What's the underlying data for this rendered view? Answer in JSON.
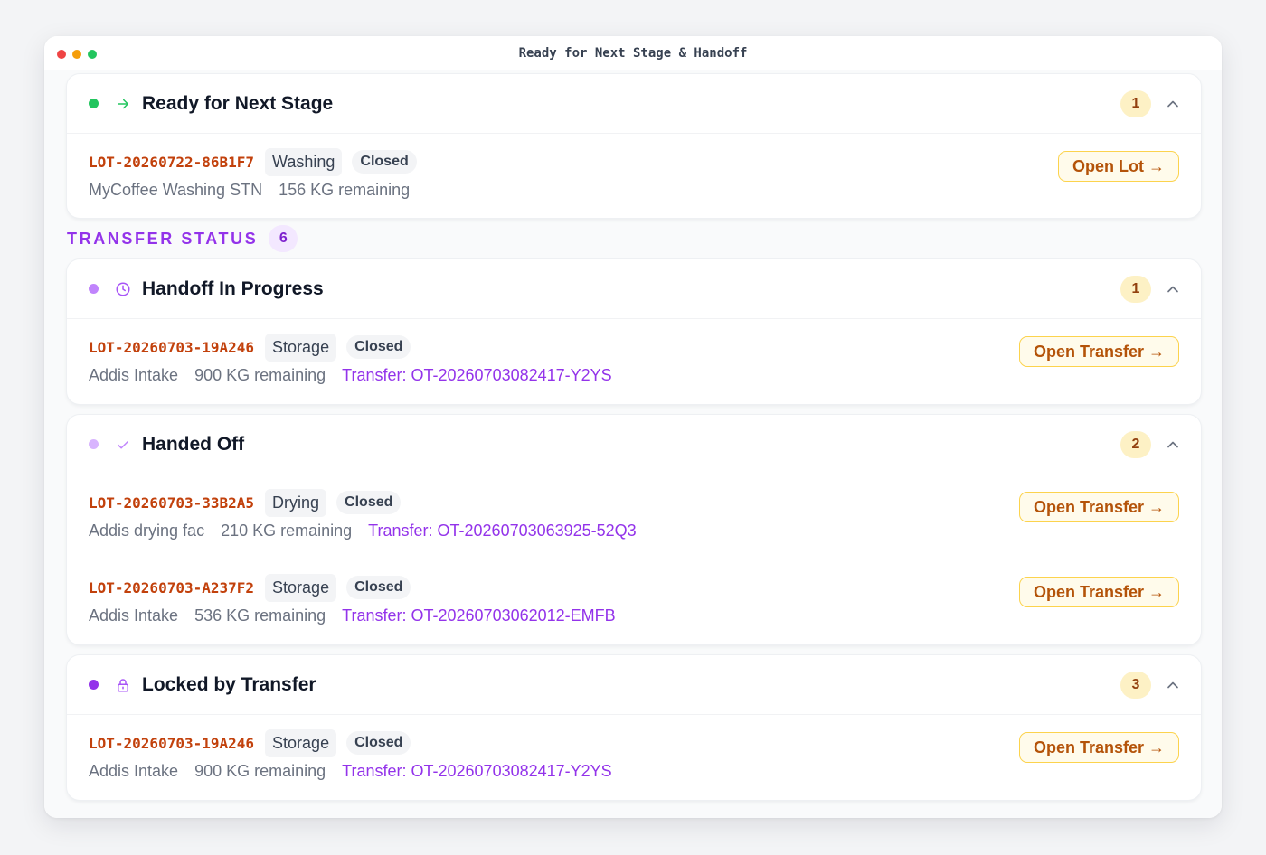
{
  "window": {
    "title": "Ready for Next Stage & Handoff"
  },
  "colors": {
    "ready": "#22c55e",
    "in_progress": "#c084fc",
    "handed_off": "#d8b4fe",
    "locked": "#9333ea",
    "lot_id": "#c2410c",
    "transfer": "#9333ea"
  },
  "ready": {
    "icon": "arrow-right-icon",
    "title": "Ready for Next Stage",
    "count": "1",
    "items": [
      {
        "lot": "LOT-20260722-86B1F7",
        "stage": "Washing",
        "status": "Closed",
        "site": "MyCoffee Washing STN",
        "qty": "156 KG remaining",
        "button": "Open Lot",
        "arrow": "→"
      }
    ]
  },
  "transfer": {
    "label": "TRANSFER STATUS",
    "count": "6",
    "groups": [
      {
        "icon": "clock-icon",
        "title": "Handoff In Progress",
        "count": "1",
        "items": [
          {
            "lot": "LOT-20260703-19A246",
            "stage": "Storage",
            "status": "Closed",
            "site": "Addis Intake",
            "qty": "900 KG remaining",
            "transfer": "Transfer: OT-20260703082417-Y2YS",
            "button": "Open Transfer",
            "arrow": "→"
          }
        ]
      },
      {
        "icon": "check-icon",
        "title": "Handed Off",
        "count": "2",
        "items": [
          {
            "lot": "LOT-20260703-33B2A5",
            "stage": "Drying",
            "status": "Closed",
            "site": "Addis drying fac",
            "qty": "210 KG remaining",
            "transfer": "Transfer: OT-20260703063925-52Q3",
            "button": "Open Transfer",
            "arrow": "→"
          },
          {
            "lot": "LOT-20260703-A237F2",
            "stage": "Storage",
            "status": "Closed",
            "site": "Addis Intake",
            "qty": "536 KG remaining",
            "transfer": "Transfer: OT-20260703062012-EMFB",
            "button": "Open Transfer",
            "arrow": "→"
          }
        ]
      },
      {
        "icon": "lock-icon",
        "title": "Locked by Transfer",
        "count": "3",
        "items": [
          {
            "lot": "LOT-20260703-19A246",
            "stage": "Storage",
            "status": "Closed",
            "site": "Addis Intake",
            "qty": "900 KG remaining",
            "transfer": "Transfer: OT-20260703082417-Y2YS",
            "button": "Open Transfer",
            "arrow": "→"
          }
        ]
      }
    ]
  }
}
